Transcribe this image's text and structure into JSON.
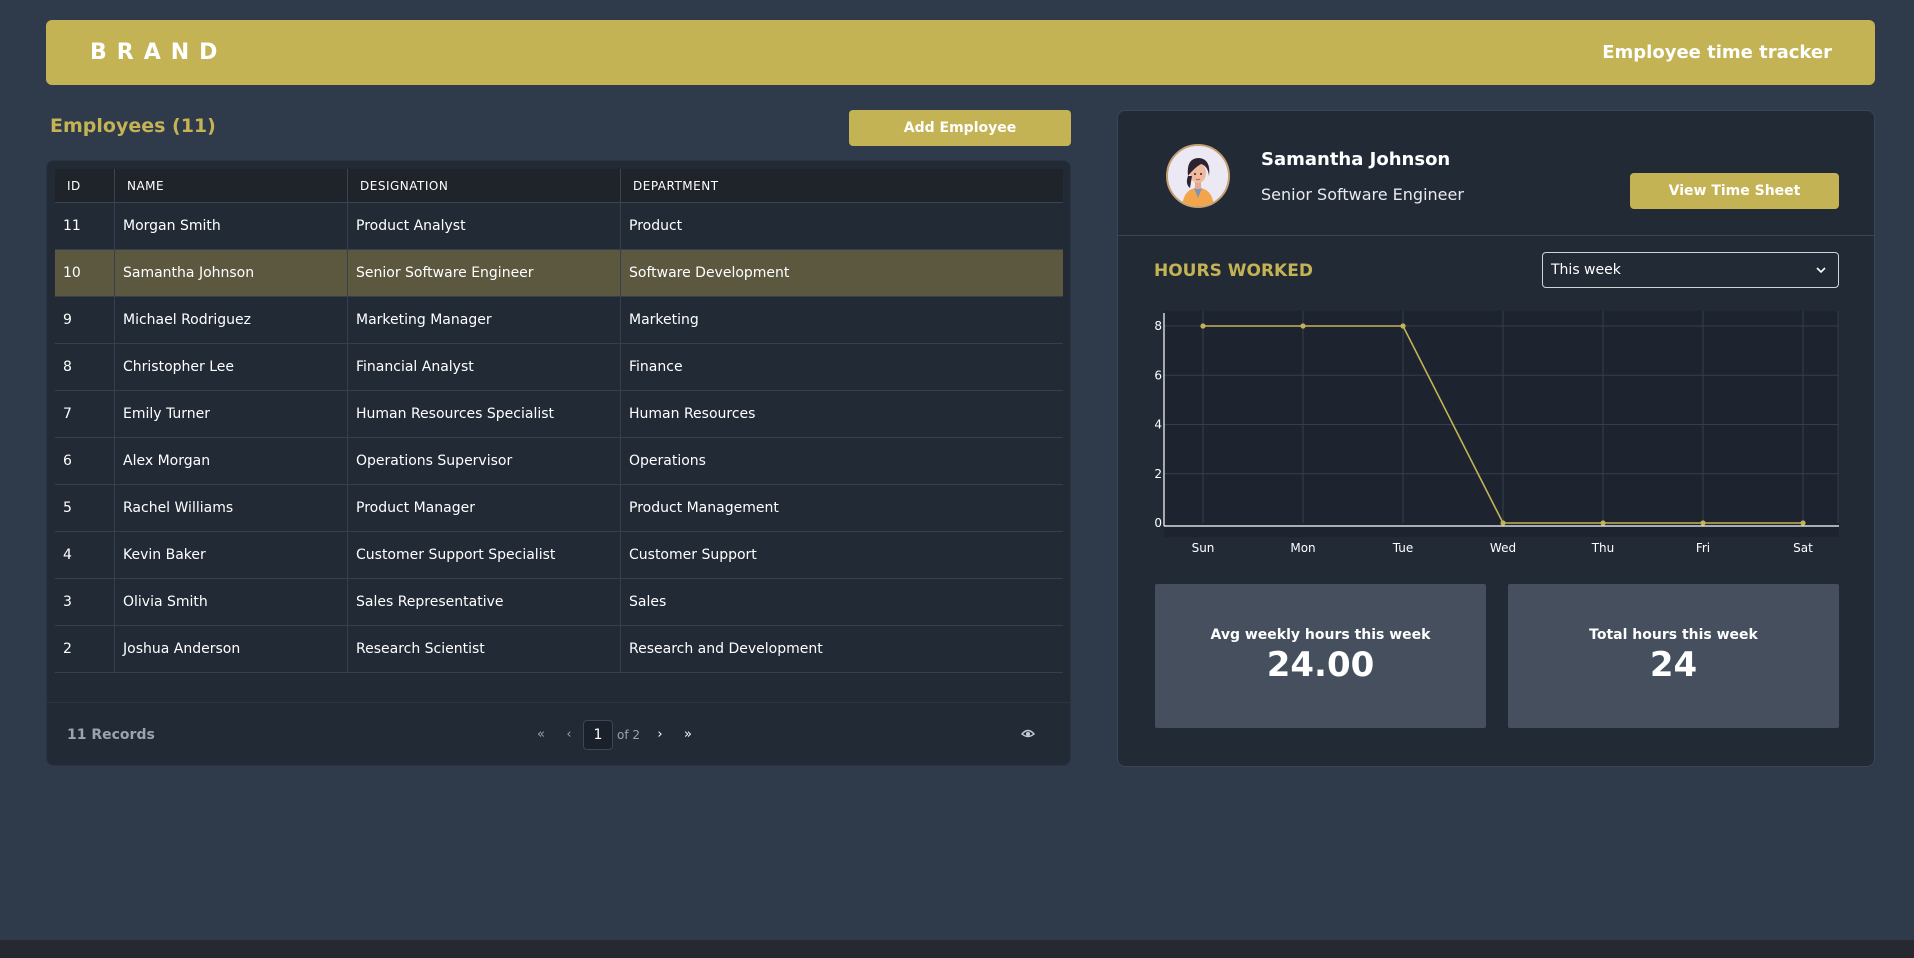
{
  "header": {
    "brand": "BRAND",
    "title": "Employee time tracker"
  },
  "employees": {
    "heading": "Employees (11)",
    "add_button": "Add Employee",
    "columns": [
      "ID",
      "NAME",
      "DESIGNATION",
      "DEPARTMENT"
    ],
    "rows": [
      {
        "id": "11",
        "name": "Morgan Smith",
        "designation": "Product Analyst",
        "department": "Product"
      },
      {
        "id": "10",
        "name": "Samantha Johnson",
        "designation": "Senior Software Engineer",
        "department": "Software Development",
        "selected": true
      },
      {
        "id": "9",
        "name": "Michael Rodriguez",
        "designation": "Marketing Manager",
        "department": "Marketing"
      },
      {
        "id": "8",
        "name": "Christopher Lee",
        "designation": "Financial Analyst",
        "department": "Finance"
      },
      {
        "id": "7",
        "name": "Emily Turner",
        "designation": "Human Resources Specialist",
        "department": "Human Resources"
      },
      {
        "id": "6",
        "name": "Alex Morgan",
        "designation": "Operations Supervisor",
        "department": "Operations"
      },
      {
        "id": "5",
        "name": "Rachel Williams",
        "designation": "Product Manager",
        "department": "Product Management"
      },
      {
        "id": "4",
        "name": "Kevin Baker",
        "designation": "Customer Support Specialist",
        "department": "Customer Support"
      },
      {
        "id": "3",
        "name": "Olivia Smith",
        "designation": "Sales Representative",
        "department": "Sales"
      },
      {
        "id": "2",
        "name": "Joshua Anderson",
        "designation": "Research Scientist",
        "department": "Research and Development"
      }
    ],
    "records": "11 Records",
    "pagination": {
      "first": "«",
      "prev": "‹",
      "page": "1",
      "of": "of 2",
      "next": "›",
      "last": "»"
    },
    "view_icon": "eye-icon"
  },
  "profile": {
    "name": "Samantha Johnson",
    "role": "Senior Software Engineer",
    "button": "View Time Sheet",
    "avatar_icon": "avatar-illustration"
  },
  "hours": {
    "title": "HOURS WORKED",
    "range": "This week",
    "avg_label": "Avg weekly hours this week",
    "avg_value": "24.00",
    "total_label": "Total hours this week",
    "total_value": "24"
  },
  "colors": {
    "accent": "#c4b354",
    "background": "#2f3a4a",
    "card": "#222a36",
    "selected_row": "#5b583f",
    "stat_card": "#454f5d"
  },
  "chart_data": {
    "type": "line",
    "categories": [
      "Sun",
      "Mon",
      "Tue",
      "Wed",
      "Thu",
      "Fri",
      "Sat"
    ],
    "values": [
      8,
      8,
      8,
      0,
      0,
      0,
      0
    ],
    "yticks": [
      0,
      2,
      4,
      6,
      8
    ],
    "ylim": [
      -0.3,
      8.3
    ],
    "grid": true,
    "line_color": "#c4b354"
  }
}
